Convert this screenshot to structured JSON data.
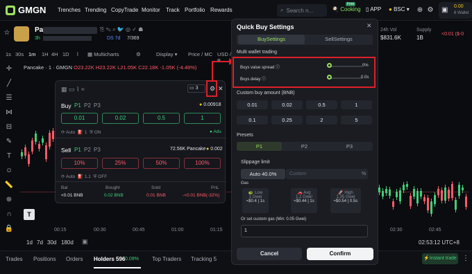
{
  "nav": {
    "logo": "GMGN",
    "items": [
      "Trenches",
      "Trending",
      "CopyTrade",
      "Monitor",
      "Track",
      "Portfolio",
      "Rewards"
    ],
    "search_placeholder": "Search n...",
    "cooking": "Cooking",
    "cooking_badge": "Free",
    "app": "APP",
    "chain": "BSC",
    "wallet_value": "0.00",
    "wallet_count": "6 Wallet"
  },
  "token": {
    "name": "Pa",
    "age": "3h",
    "ds": "DS 7d",
    "holders_ratio": "7/369"
  },
  "stats": {
    "vol_label": "24h Vol",
    "vol_value": "$831.6K",
    "supply_label": "Supply",
    "supply_value": "1B",
    "partial_value": "<0.01 ($-0",
    "partial_top": "USD"
  },
  "chart_toolbar": {
    "intervals": [
      "1s",
      "30s",
      "1m",
      "1H",
      "4H",
      "1D"
    ],
    "multicharts": "Multicharts",
    "display": "Display",
    "price_mc": "Price / MC",
    "usd": "USD / B"
  },
  "chart_header": {
    "pair": "Pancake · 1 · GMGN",
    "o": "O23.22K",
    "h": "H23.22K",
    "l": "L21.05K",
    "c": "C22.18K",
    "change": "-1.05K (-4.48%)"
  },
  "time_axis": [
    "00:15",
    "00:30",
    "00:45",
    "01:00",
    "01:15",
    "01:30",
    "02:30",
    "02:45"
  ],
  "time_ranges": [
    "1d",
    "7d",
    "30d",
    "180d"
  ],
  "clock": "02:53:12 UTC+8",
  "bottom_tabs": [
    "Trades",
    "Positions",
    "Orders",
    "Holders 596",
    "Top Traders",
    "Tracking 5",
    "D"
  ],
  "holders_badge": "0.09%",
  "instant_trade": "Instant trade",
  "mini": {
    "buy_label": "Buy",
    "presets": [
      "P1",
      "P2",
      "P3"
    ],
    "balance": "0.00918",
    "buy_amounts": [
      "0.01",
      "0.02",
      "0.5",
      "1"
    ],
    "auto": "Auto",
    "gas": "1",
    "on": "ON",
    "adv": "Adv.",
    "sell_label": "Sell",
    "sell_balance": "72.56K Pancake",
    "sell_bnb": "0.002",
    "sell_amounts": [
      "10%",
      "25%",
      "50%",
      "100%"
    ],
    "gas2": "1.1",
    "off": "OFF",
    "table_headers": [
      "Bal",
      "Bought",
      "Sold",
      "PnL"
    ],
    "table_values": [
      "<0.01 BNB",
      "0.02 BNB",
      "0.01 BNB",
      "-<0.01 BNB(-32%)"
    ],
    "count": "3"
  },
  "modal": {
    "title": "Quick Buy Settings",
    "tabs": [
      "BuySettings",
      "SellSettings"
    ],
    "multi_wallet": "Multi wallet trading",
    "spread_label": "Buys value spread",
    "spread_value": "0%",
    "delay_label": "Buys delay",
    "delay_value": "0.0s",
    "custom_buy": "Custom buy amount (BNB)",
    "amounts": [
      "0.01",
      "0.02",
      "0.5",
      "1",
      "0.1",
      "0.25",
      "2",
      "5"
    ],
    "presets_label": "Presets",
    "presets": [
      "P1",
      "P2",
      "P3"
    ],
    "slippage_label": "Slippage limit",
    "slippage_auto": "Auto 40.0%",
    "slippage_custom": "Custom",
    "percent": "%",
    "gas_label": "Gas",
    "gas_cards": [
      {
        "name": "Low",
        "gwei": "1 Gwei",
        "cost": "≈$0.4 | 1s"
      },
      {
        "name": "Avg",
        "gwei": "1.1 Gwei",
        "cost": "≈$0.44 | 1s"
      },
      {
        "name": "High",
        "gwei": "1.35 Gwei",
        "cost": "≈$0.54 | 0.5s"
      }
    ],
    "custom_gas_label": "Or set custom gas (Min: 0.05 Gwei)",
    "custom_gas_value": "1",
    "cancel": "Cancel",
    "confirm": "Confirm"
  },
  "colors": {
    "accent": "#9be15d",
    "buy": "#3ecf7a",
    "sell": "#ff5a6a",
    "highlight": "#e0202a"
  }
}
